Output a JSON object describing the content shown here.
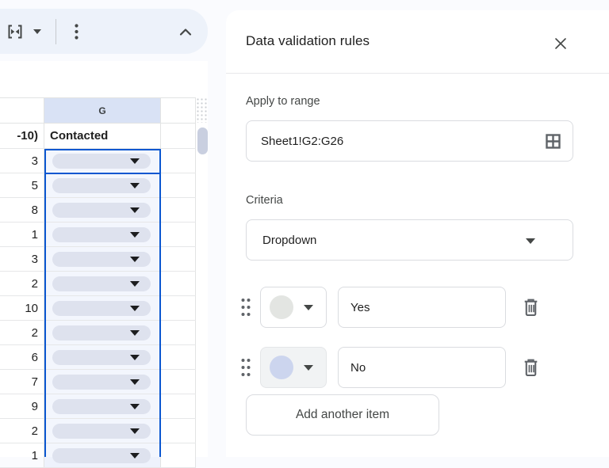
{
  "toolbar": {
    "icons": {
      "merge": "merge-cells-icon",
      "merge_dropdown": "chevron-down-icon",
      "more": "kebab-menu-icon",
      "collapse": "chevron-up-icon"
    }
  },
  "sheet": {
    "column_header": "G",
    "header_row": {
      "f": "-10)",
      "g": "Contacted"
    },
    "rows": [
      {
        "f": "3"
      },
      {
        "f": "5"
      },
      {
        "f": "8"
      },
      {
        "f": "1"
      },
      {
        "f": "3"
      },
      {
        "f": "2"
      },
      {
        "f": "10"
      },
      {
        "f": "2"
      },
      {
        "f": "6"
      },
      {
        "f": "7"
      },
      {
        "f": "9"
      },
      {
        "f": "2"
      },
      {
        "f": "1"
      }
    ]
  },
  "panel": {
    "title": "Data validation rules",
    "apply_to_range": {
      "label": "Apply to range",
      "value": "Sheet1!G2:G26"
    },
    "criteria": {
      "label": "Criteria",
      "value": "Dropdown"
    },
    "items": [
      {
        "value": "Yes",
        "color": "#e3e5e2"
      },
      {
        "value": "No",
        "color": "#ccd5ee"
      }
    ],
    "add_button_label": "Add another item"
  },
  "colors": {
    "accent_blue": "#0b57d0",
    "toolbar_bg": "#edf2fa",
    "selected_column_header_bg": "#d9e2f5",
    "dropdown_pill_bg": "#dee2ee",
    "icon_gray": "#5f6368",
    "border_gray": "#dadce0"
  }
}
